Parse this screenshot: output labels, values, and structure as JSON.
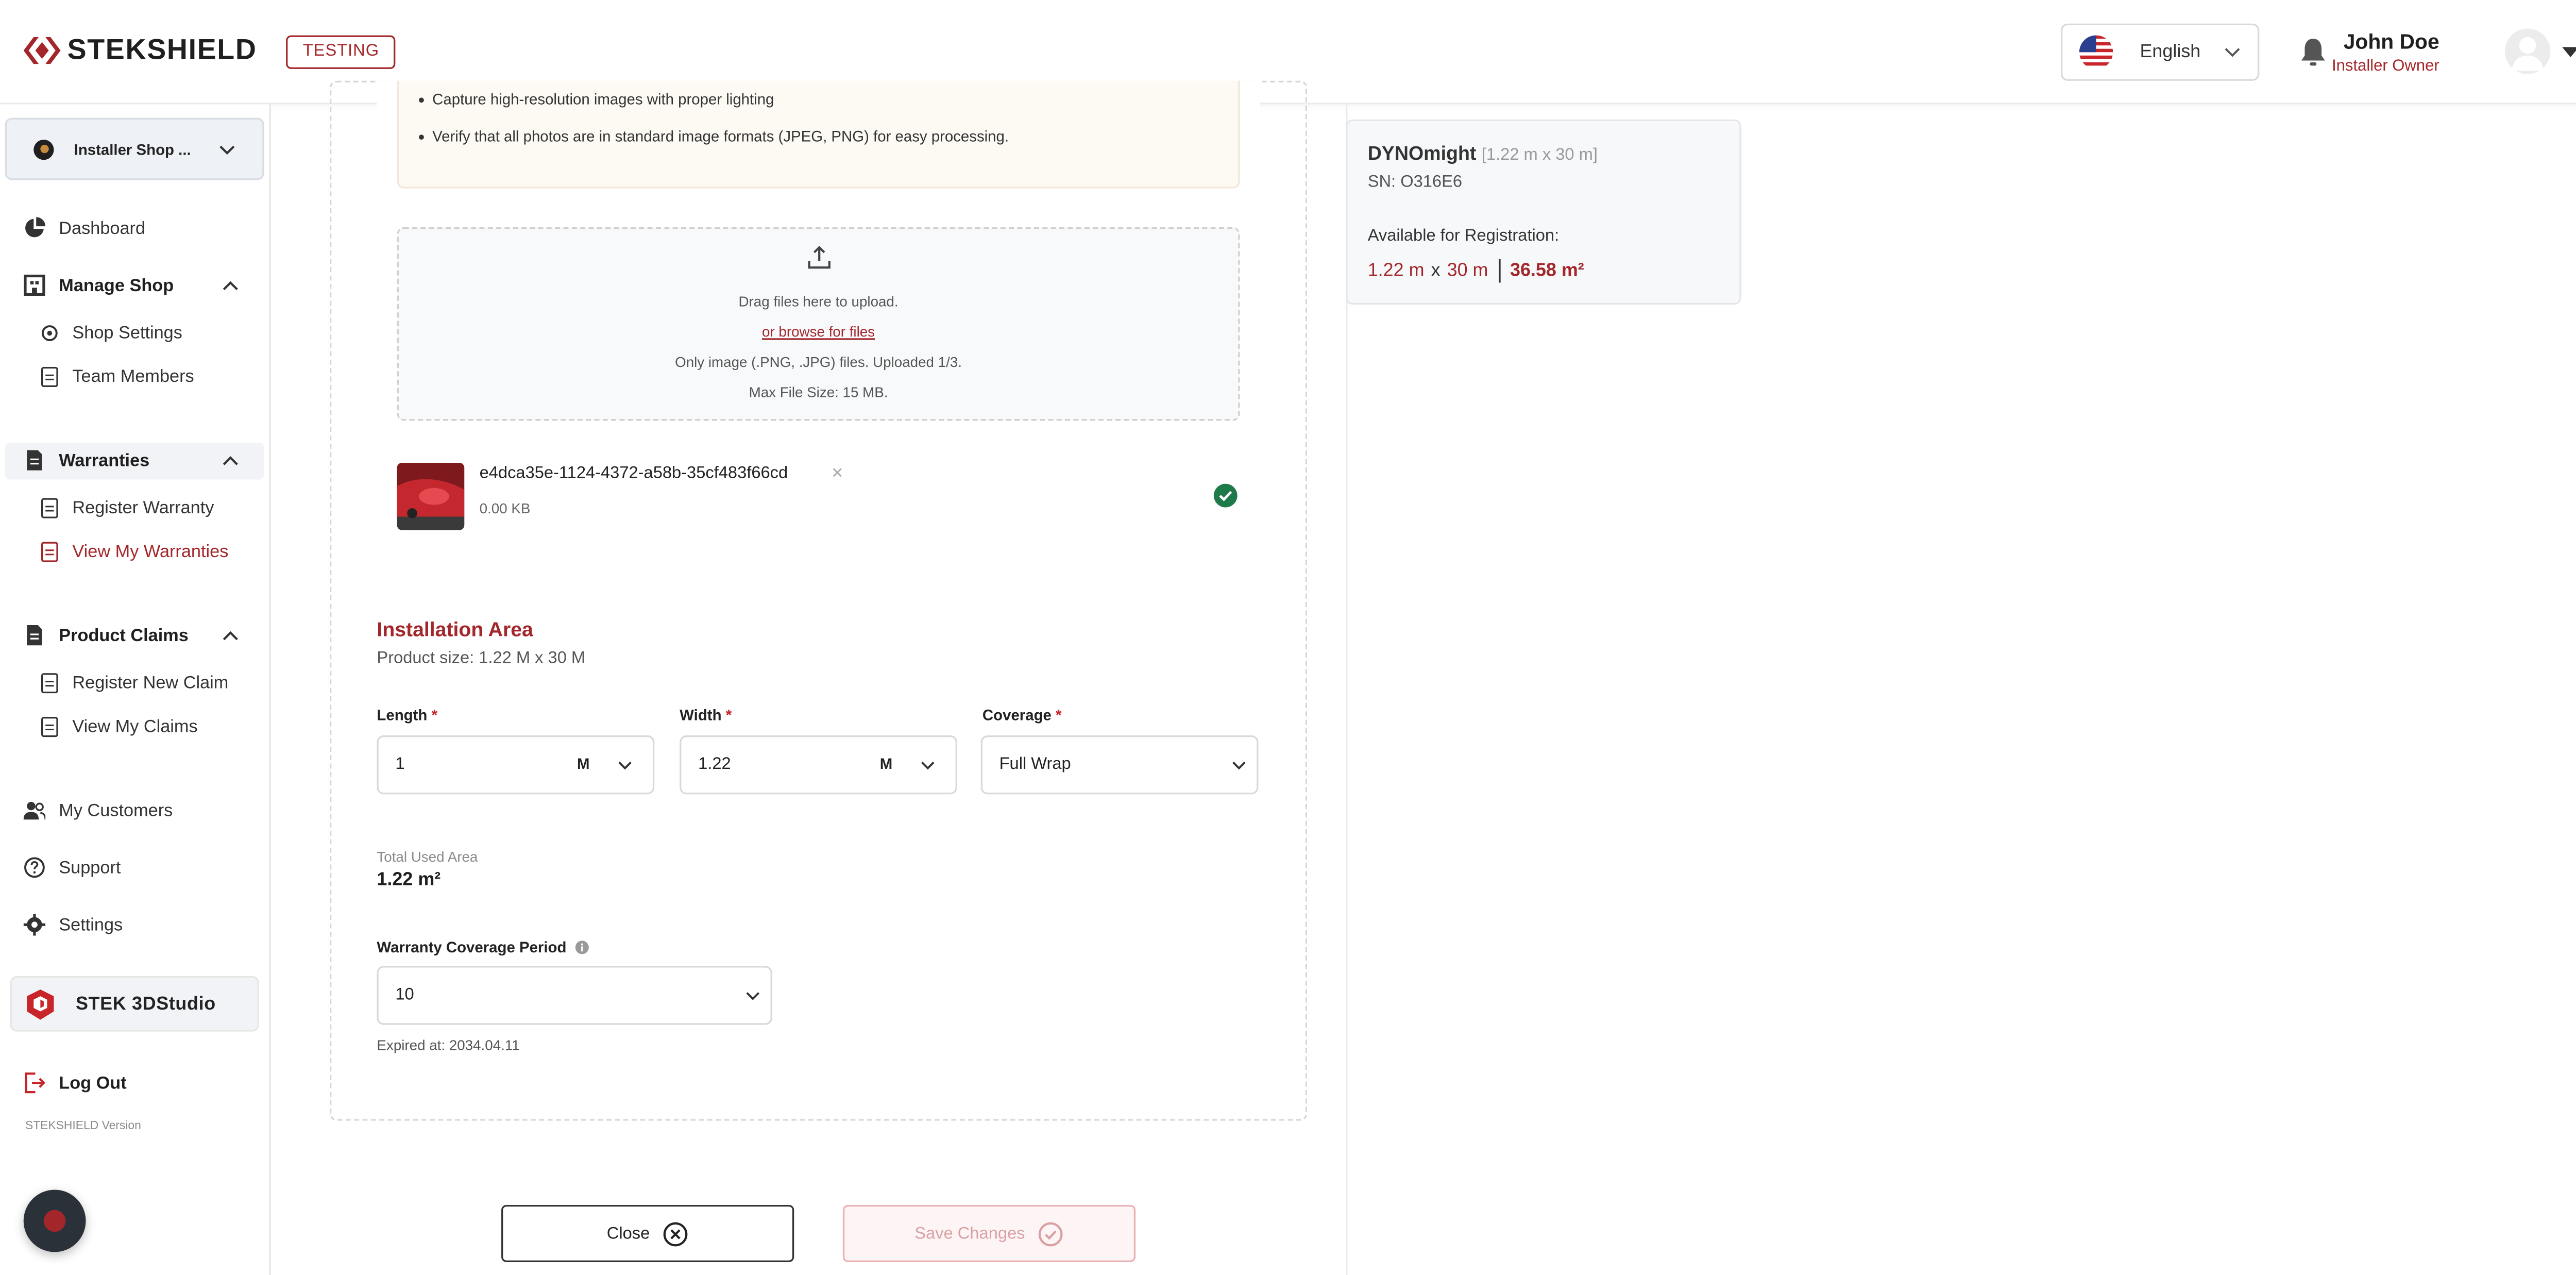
{
  "header": {
    "brand": "STEKSHIELD",
    "env_badge": "TESTING",
    "language": "English",
    "user_name": "John Doe",
    "user_role": "Installer Owner",
    "icons": [
      "logo-icon",
      "us-flag-icon",
      "chevron-down-icon",
      "bell-icon",
      "avatar-icon",
      "caret-down-icon"
    ]
  },
  "sidebar": {
    "shop_name": "Installer Shop ...",
    "dashboard": "Dashboard",
    "manage_shop": "Manage Shop",
    "shop_settings": "Shop Settings",
    "team_members": "Team Members",
    "warranties": "Warranties",
    "register_warranty": "Register Warranty",
    "view_my_warranties": "View My Warranties",
    "product_claims": "Product Claims",
    "register_new_claim": "Register New Claim",
    "view_my_claims": "View My Claims",
    "my_customers": "My Customers",
    "support": "Support",
    "settings": "Settings",
    "studio": "STEK 3DStudio",
    "logout": "Log Out",
    "version": "STEKSHIELD Version"
  },
  "photos": {
    "tips": [
      "Capture high-resolution images with proper lighting",
      "Verify that all photos are in standard image formats (JPEG, PNG) for easy processing."
    ],
    "dropzone": {
      "line1": "Drag files here to upload.",
      "browse": "or browse for files",
      "line3": "Only image (.PNG, .JPG) files. Uploaded 1/3.",
      "line4": "Max File Size: 15 MB."
    },
    "file": {
      "name": "e4dca35e-1124-4372-a58b-35cf483f66cd",
      "remove": "✕",
      "size": "0.00 KB"
    }
  },
  "installation": {
    "title": "Installation Area",
    "product_size": "Product size: 1.22 M x 30 M",
    "length_label": "Length",
    "length_value": "1",
    "length_unit": "M",
    "width_label": "Width",
    "width_value": "1.22",
    "width_unit": "M",
    "coverage_label": "Coverage",
    "coverage_value": "Full Wrap",
    "required_mark": "*",
    "total_label": "Total Used Area",
    "total_value": "1.22 m²",
    "period_label": "Warranty Coverage Period",
    "period_value": "10",
    "expired": "Expired at: 2034.04.11"
  },
  "actions": {
    "close": "Close",
    "save": "Save Changes"
  },
  "product": {
    "name": "DYNOmight",
    "dims": "[1.22 m x 30 m]",
    "sn": "SN: O316E6",
    "avail_label": "Available for Registration:",
    "avail_length": "1.22 m",
    "avail_x": "x",
    "avail_width": "30 m",
    "avail_area": "36.58 m²"
  },
  "colors": {
    "brand": "#a3262a",
    "text": "#222222",
    "muted": "#8a8a8a",
    "success": "#1f7a4a"
  }
}
